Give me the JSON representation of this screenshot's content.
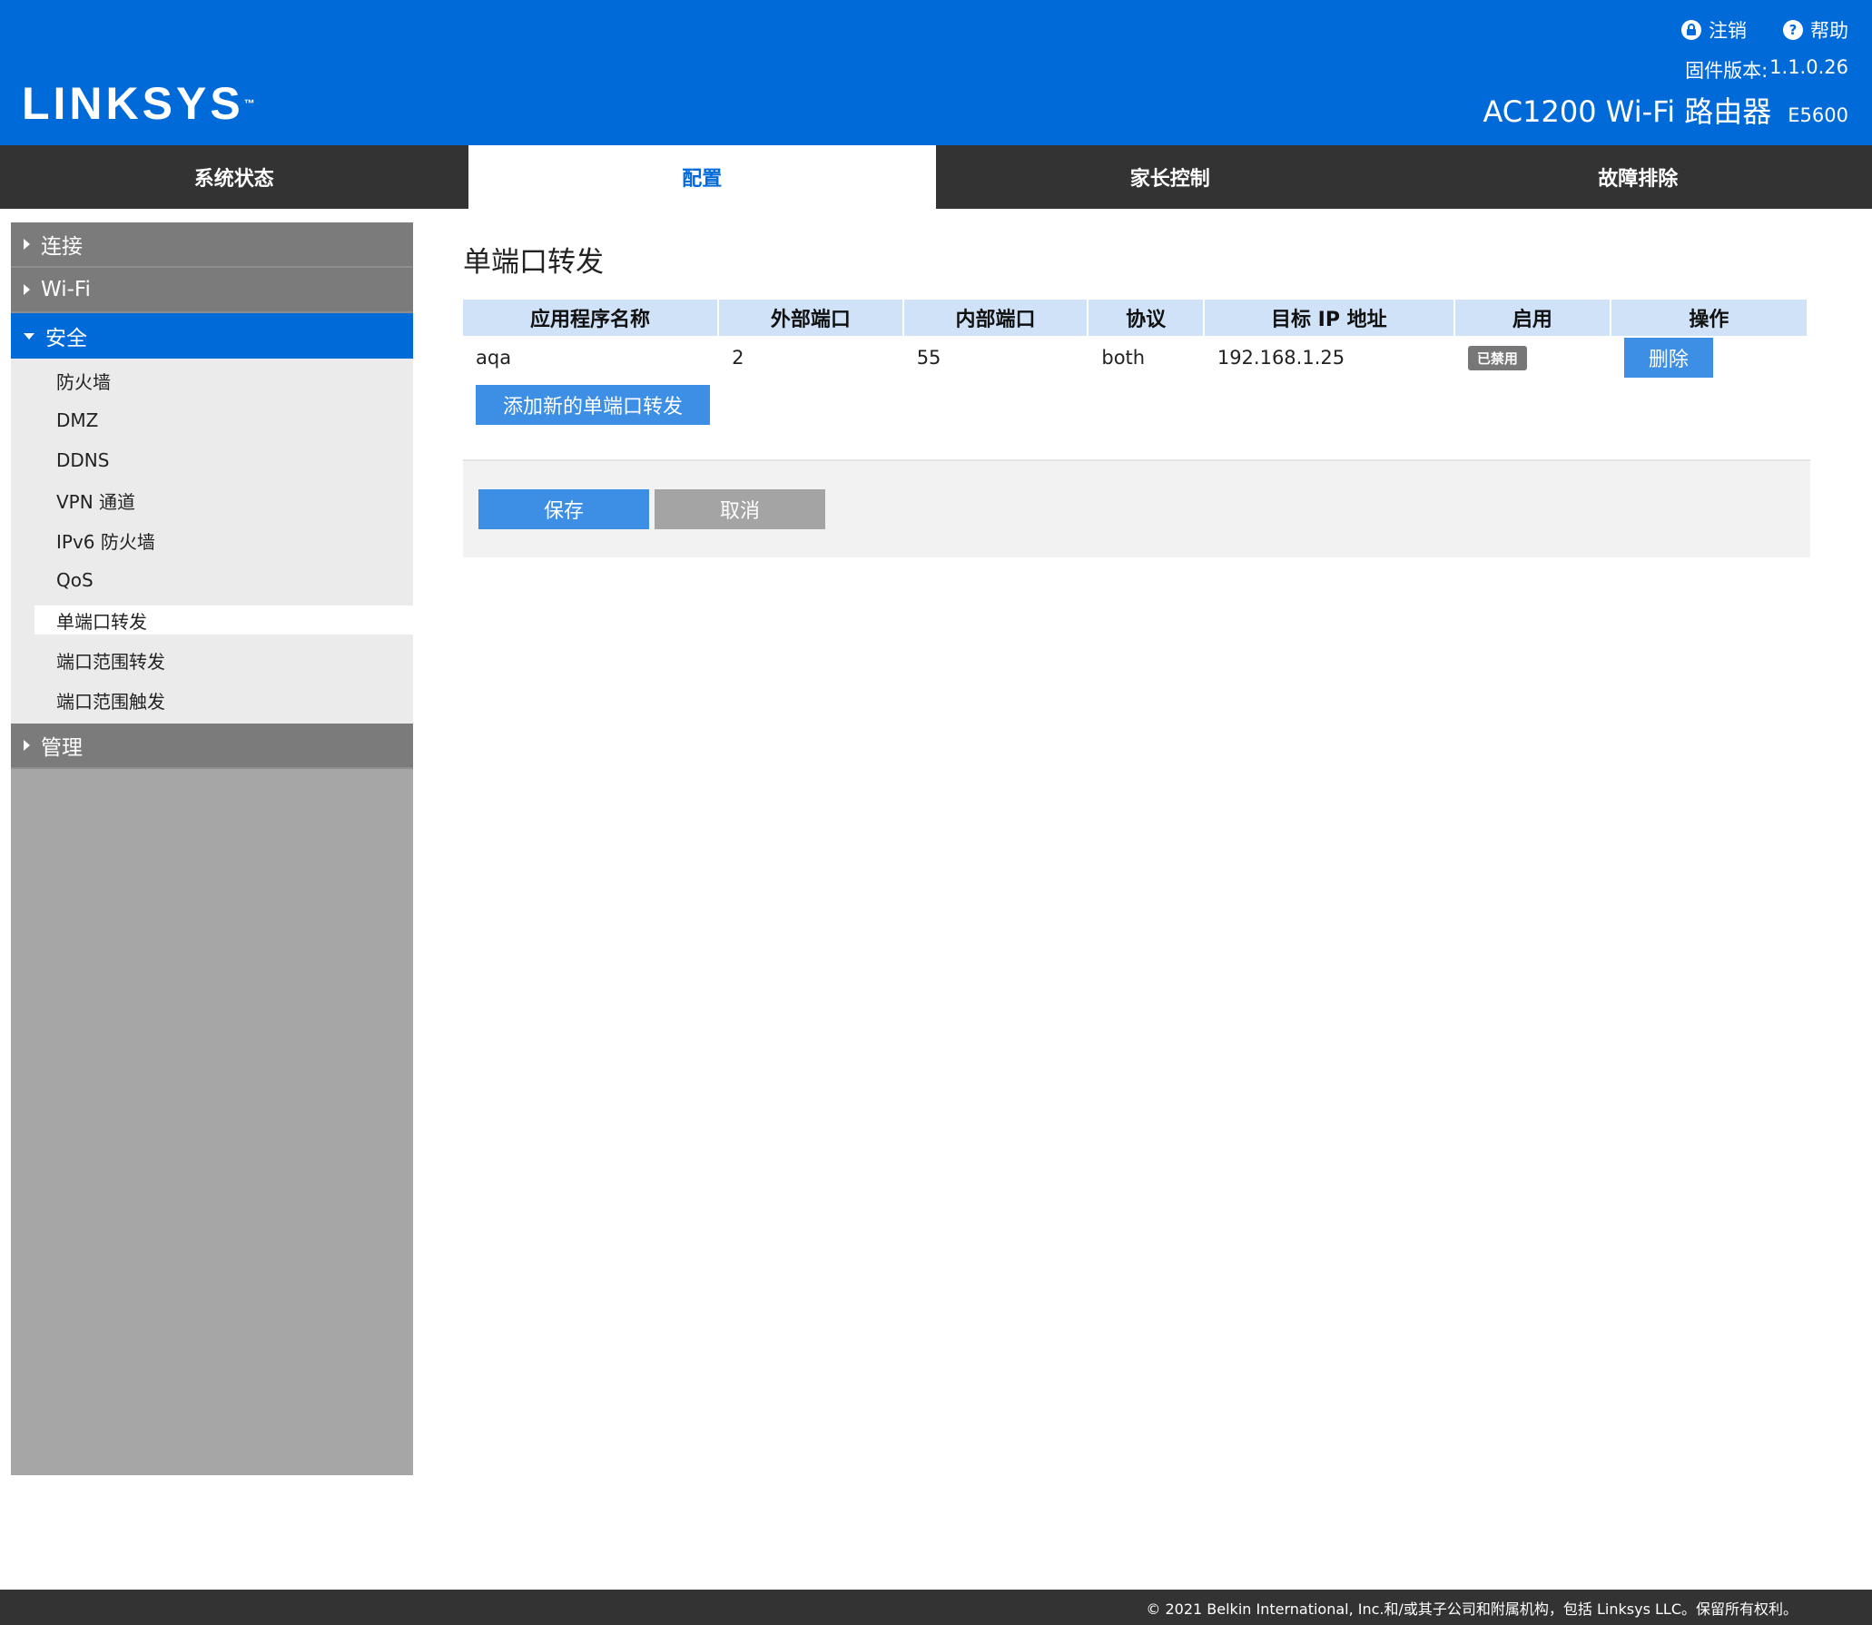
{
  "header": {
    "logo": "LINKSYS",
    "logo_tm": "™",
    "logout_label": "注销",
    "help_label": "帮助",
    "firmware_label": "固件版本:",
    "firmware_version": "1.1.0.26",
    "product_name": "AC1200 Wi-Fi 路由器",
    "model": "E5600"
  },
  "tabs": [
    {
      "label": "系统状态"
    },
    {
      "label": "配置"
    },
    {
      "label": "家长控制"
    },
    {
      "label": "故障排除"
    }
  ],
  "sidebar": {
    "sections": [
      {
        "label": "连接"
      },
      {
        "label": "Wi-Fi"
      },
      {
        "label": "安全"
      },
      {
        "label": "管理"
      }
    ],
    "security_items": [
      {
        "label": "防火墙"
      },
      {
        "label": "DMZ"
      },
      {
        "label": "DDNS"
      },
      {
        "label": "VPN 通道"
      },
      {
        "label": "IPv6 防火墙"
      },
      {
        "label": "QoS"
      },
      {
        "label": "单端口转发"
      },
      {
        "label": "端口范围转发"
      },
      {
        "label": "端口范围触发"
      }
    ]
  },
  "main": {
    "title": "单端口转发",
    "columns": [
      "应用程序名称",
      "外部端口",
      "内部端口",
      "协议",
      "目标 IP 地址",
      "启用",
      "操作"
    ],
    "rows": [
      {
        "app_name": "aqa",
        "external_port": "2",
        "internal_port": "55",
        "protocol": "both",
        "target_ip": "192.168.1.25",
        "status": "已禁用",
        "action": "删除"
      }
    ],
    "add_label": "添加新的单端口转发",
    "save_label": "保存",
    "cancel_label": "取消"
  },
  "footer": {
    "text": "© 2021 Belkin International, Inc.和/或其子公司和附属机构，包括 Linksys LLC。保留所有权利。"
  },
  "colors": {
    "brand_blue": "#006ad9",
    "tab_bar": "#333333",
    "button_blue": "#3d8fe6",
    "table_header": "#cfe2f7"
  }
}
